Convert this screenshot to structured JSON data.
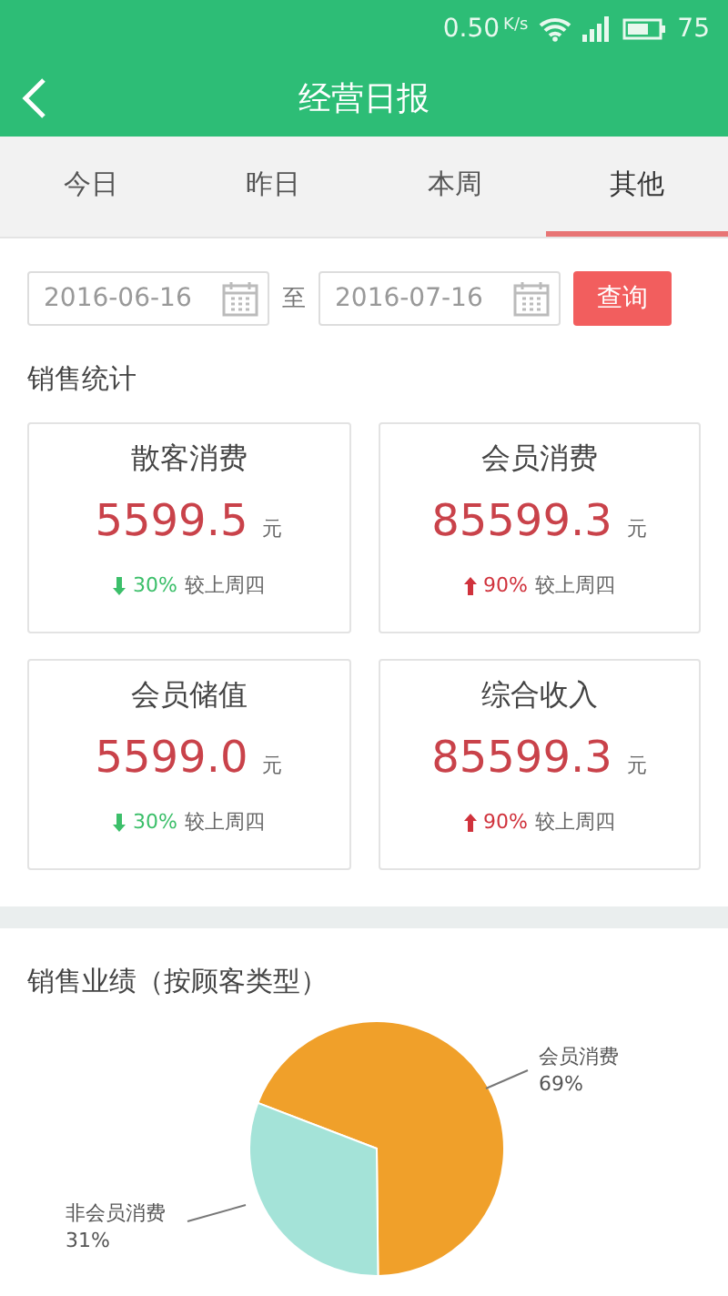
{
  "status_bar": {
    "speed": "0.50",
    "speed_unit": "K/s",
    "battery": "75"
  },
  "header": {
    "title": "经营日报"
  },
  "tabs": [
    {
      "label": "今日",
      "selected": false
    },
    {
      "label": "昨日",
      "selected": false
    },
    {
      "label": "本周",
      "selected": false
    },
    {
      "label": "其他",
      "selected": true
    }
  ],
  "date_range": {
    "start": "2016-06-16",
    "separator": "至",
    "end": "2016-07-16",
    "button": "查询"
  },
  "sales_stats": {
    "title": "销售统计",
    "cards": [
      {
        "title": "散客消费",
        "value": "5599.5",
        "unit": "元",
        "kind": "down",
        "change": "30%",
        "compare": "较上周四"
      },
      {
        "title": "会员消费",
        "value": "85599.3",
        "unit": "元",
        "kind": "up",
        "change": "90%",
        "compare": "较上周四"
      },
      {
        "title": "会员储值",
        "value": "5599.0",
        "unit": "元",
        "kind": "down",
        "change": "30%",
        "compare": "较上周四"
      },
      {
        "title": "综合收入",
        "value": "85599.3",
        "unit": "元",
        "kind": "up",
        "change": "90%",
        "compare": "较上周四"
      }
    ]
  },
  "performance": {
    "title": "销售业绩（按顾客类型）",
    "chart_data": {
      "type": "pie",
      "categories": [
        "会员消费",
        "非会员消费"
      ],
      "values": [
        69,
        31
      ],
      "colors": [
        "#f0a02a",
        "#a4e3d8"
      ],
      "value_labels": [
        "69%",
        "31%"
      ]
    }
  }
}
